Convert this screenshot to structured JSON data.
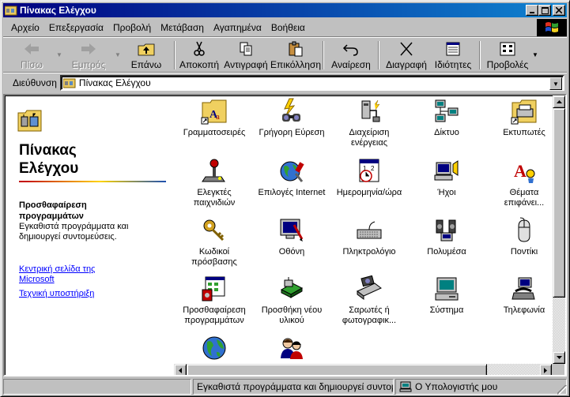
{
  "window": {
    "title": "Πίνακας Ελέγχου"
  },
  "menu": [
    {
      "label": "Αρχείο"
    },
    {
      "label": "Επεξεργασία"
    },
    {
      "label": "Προβολή"
    },
    {
      "label": "Μετάβαση"
    },
    {
      "label": "Αγαπημένα"
    },
    {
      "label": "Βοήθεια"
    }
  ],
  "toolbar": {
    "back": "Πίσω",
    "forward": "Εμπρός",
    "up": "Επάνω",
    "cut": "Αποκοπή",
    "copy": "Αντιγραφή",
    "paste": "Επικόλληση",
    "undo": "Αναίρεση",
    "delete": "Διαγραφή",
    "properties": "Ιδιότητες",
    "views": "Προβολές"
  },
  "address": {
    "label": "Διεύθυνση",
    "value": "Πίνακας Ελέγχου"
  },
  "left_pane": {
    "title_line1": "Πίνακας",
    "title_line2": "Ελέγχου",
    "selected_name_line1": "Προσθαφαίρεση",
    "selected_name_line2": "προγραμμάτων",
    "selected_desc": "Εγκαθιστά προγράμματα και δημιουργεί συντομεύσεις.",
    "link1_line1": "Κεντρική σελίδα της",
    "link1_line2": "Microsoft",
    "link2": "Τεχνική υποστήριξη"
  },
  "items": [
    {
      "line1": "Γραμματοσειρές",
      "line2": "",
      "icon": "fonts-icon"
    },
    {
      "line1": "Γρήγορη Εύρεση",
      "line2": "",
      "icon": "find-fast-icon"
    },
    {
      "line1": "Διαχείριση",
      "line2": "ενέργειας",
      "icon": "power-icon"
    },
    {
      "line1": "Δίκτυο",
      "line2": "",
      "icon": "network-icon"
    },
    {
      "line1": "Εκτυπωτές",
      "line2": "",
      "icon": "printers-icon"
    },
    {
      "line1": "Ελεγκτές",
      "line2": "παιχνιδιών",
      "icon": "joystick-icon"
    },
    {
      "line1": "Επιλογές Internet",
      "line2": "",
      "icon": "internet-icon"
    },
    {
      "line1": "Ημερομηνία/ώρα",
      "line2": "",
      "icon": "datetime-icon"
    },
    {
      "line1": "Ήχοι",
      "line2": "",
      "icon": "sounds-icon"
    },
    {
      "line1": "Θέματα",
      "line2": "επιφάνει...",
      "icon": "themes-icon"
    },
    {
      "line1": "Κωδικοί",
      "line2": "πρόσβασης",
      "icon": "passwords-icon"
    },
    {
      "line1": "Οθόνη",
      "line2": "",
      "icon": "display-icon"
    },
    {
      "line1": "Πληκτρολόγιο",
      "line2": "",
      "icon": "keyboard-icon"
    },
    {
      "line1": "Πολυμέσα",
      "line2": "",
      "icon": "multimedia-icon"
    },
    {
      "line1": "Ποντίκι",
      "line2": "",
      "icon": "mouse-icon"
    },
    {
      "line1": "Προσθαφαίρεση",
      "line2": "προγραμμάτων",
      "icon": "add-remove-icon"
    },
    {
      "line1": "Προσθήκη νέου",
      "line2": "υλικού",
      "icon": "add-hardware-icon"
    },
    {
      "line1": "Σαρωτές ή",
      "line2": "φωτογραφικ...",
      "icon": "scanner-icon"
    },
    {
      "line1": "Σύστημα",
      "line2": "",
      "icon": "system-icon"
    },
    {
      "line1": "Τηλεφωνία",
      "line2": "",
      "icon": "telephony-icon"
    },
    {
      "line1": "",
      "line2": "",
      "icon": "regional-icon"
    },
    {
      "line1": "",
      "line2": "",
      "icon": "users-icon"
    }
  ],
  "status": {
    "message": "Εγκαθιστά προγράμματα και δημιουργεί συντομ",
    "zone": "Ο Υπολογιστής μου"
  }
}
